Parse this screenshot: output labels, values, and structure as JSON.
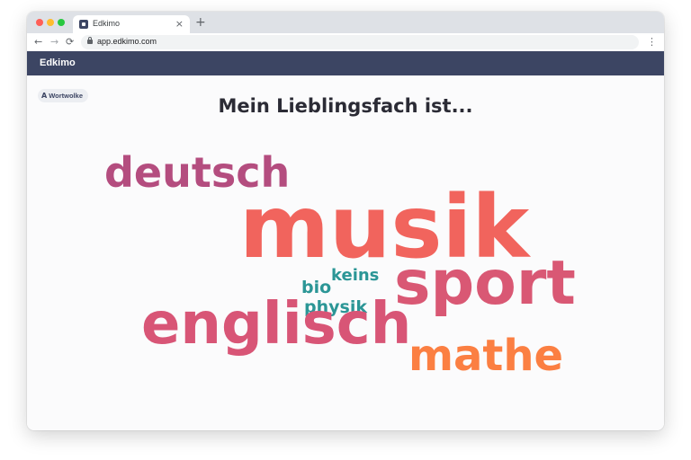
{
  "browser": {
    "tab_title": "Edkimo",
    "tab_close": "×",
    "new_tab": "+",
    "back": "←",
    "forward": "→",
    "reload": "⟳",
    "url": "app.edkimo.com",
    "menu": "⋮"
  },
  "app": {
    "name": "Edkimo"
  },
  "chip": {
    "icon": "A",
    "label": "Wortwolke"
  },
  "question": "Mein Lieblingsfach ist...",
  "words": {
    "musik": {
      "text": "musik",
      "color": "#f1645d"
    },
    "deutsch": {
      "text": "deutsch",
      "color": "#b44d7f"
    },
    "sport": {
      "text": "sport",
      "color": "#d95874"
    },
    "englisch": {
      "text": "englisch",
      "color": "#d85576"
    },
    "mathe": {
      "text": "mathe",
      "color": "#fb7f42"
    },
    "bio": {
      "text": "bio",
      "color": "#2b9696"
    },
    "keins": {
      "text": "keins",
      "color": "#2b9696"
    },
    "physik": {
      "text": "physik",
      "color": "#2b9696"
    }
  }
}
